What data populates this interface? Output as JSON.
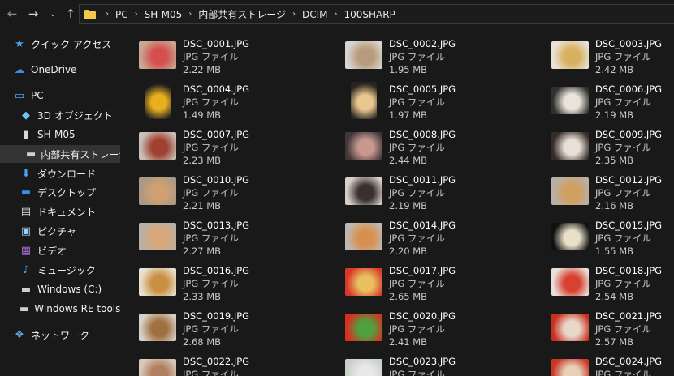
{
  "addressbar": {
    "back_icon": "arrow-left-icon",
    "forward_icon": "arrow-right-icon",
    "recent_icon": "chevron-down-icon",
    "up_icon": "arrow-up-icon",
    "crumbs": [
      "PC",
      "SH-M05",
      "内部共有ストレージ",
      "DCIM",
      "100SHARP"
    ]
  },
  "sidebar": {
    "items": [
      {
        "label": "クイック アクセス",
        "icon": "star-icon",
        "color": "#4aa3f0"
      },
      {
        "label": "OneDrive",
        "icon": "cloud-icon",
        "color": "#3b8ee8"
      },
      {
        "label": "PC",
        "icon": "computer-icon",
        "color": "#5aa8e8"
      },
      {
        "label": "3D オブジェクト",
        "icon": "cube-icon",
        "color": "#6bc4f0"
      },
      {
        "label": "SH-M05",
        "icon": "phone-icon",
        "color": "#cfd8e0"
      },
      {
        "label": "内部共有ストレージ",
        "icon": "drive-icon",
        "color": "#cfcfcf"
      },
      {
        "label": "ダウンロード",
        "icon": "download-icon",
        "color": "#4aa3f0"
      },
      {
        "label": "デスクトップ",
        "icon": "desktop-icon",
        "color": "#3b8ee8"
      },
      {
        "label": "ドキュメント",
        "icon": "document-icon",
        "color": "#dcdcdc"
      },
      {
        "label": "ピクチャ",
        "icon": "pictures-icon",
        "color": "#9ad0f5"
      },
      {
        "label": "ビデオ",
        "icon": "video-icon",
        "color": "#b070e0"
      },
      {
        "label": "ミュージック",
        "icon": "music-icon",
        "color": "#4aa3f0"
      },
      {
        "label": "Windows (C:)",
        "icon": "drive-icon",
        "color": "#cfcfcf"
      },
      {
        "label": "Windows RE tools (I",
        "icon": "drive-icon",
        "color": "#cfcfcf"
      },
      {
        "label": "ネットワーク",
        "icon": "network-icon",
        "color": "#5aa8e8"
      }
    ]
  },
  "files": [
    {
      "name": "DSC_0001.JPG",
      "type": "JPG ファイル",
      "size": "2.22 MB",
      "colors": [
        "#c8a890",
        "#d45050"
      ]
    },
    {
      "name": "DSC_0002.JPG",
      "type": "JPG ファイル",
      "size": "1.95 MB",
      "colors": [
        "#d8d4d0",
        "#b89a7c"
      ]
    },
    {
      "name": "DSC_0003.JPG",
      "type": "JPG ファイル",
      "size": "2.42 MB",
      "colors": [
        "#e8e2d8",
        "#d8b060"
      ]
    },
    {
      "name": "DSC_0004.JPG",
      "type": "JPG ファイル",
      "size": "1.49 MB",
      "colors": [
        "#1a1a20",
        "#e8b020"
      ]
    },
    {
      "name": "DSC_0005.JPG",
      "type": "JPG ファイル",
      "size": "1.97 MB",
      "colors": [
        "#2a2420",
        "#e8c890"
      ]
    },
    {
      "name": "DSC_0006.JPG",
      "type": "JPG ファイル",
      "size": "2.19 MB",
      "colors": [
        "#30302c",
        "#e8e4dc"
      ]
    },
    {
      "name": "DSC_0007.JPG",
      "type": "JPG ファイル",
      "size": "2.23 MB",
      "colors": [
        "#c8c0b8",
        "#a04030"
      ]
    },
    {
      "name": "DSC_0008.JPG",
      "type": "JPG ファイル",
      "size": "2.44 MB",
      "colors": [
        "#403838",
        "#c89890"
      ]
    },
    {
      "name": "DSC_0009.JPG",
      "type": "JPG ファイル",
      "size": "2.35 MB",
      "colors": [
        "#382c28",
        "#e8e0d8"
      ]
    },
    {
      "name": "DSC_0010.JPG",
      "type": "JPG ファイル",
      "size": "2.21 MB",
      "colors": [
        "#a89888",
        "#d0a070"
      ]
    },
    {
      "name": "DSC_0011.JPG",
      "type": "JPG ファイル",
      "size": "2.19 MB",
      "colors": [
        "#d8d0c8",
        "#3a3030"
      ]
    },
    {
      "name": "DSC_0012.JPG",
      "type": "JPG ファイル",
      "size": "2.16 MB",
      "colors": [
        "#b8b0a8",
        "#d0a060"
      ]
    },
    {
      "name": "DSC_0013.JPG",
      "type": "JPG ファイル",
      "size": "2.27 MB",
      "colors": [
        "#b8b0a8",
        "#d8a878"
      ]
    },
    {
      "name": "DSC_0014.JPG",
      "type": "JPG ファイル",
      "size": "2.20 MB",
      "colors": [
        "#c0b8b0",
        "#d89050"
      ]
    },
    {
      "name": "DSC_0015.JPG",
      "type": "JPG ファイル",
      "size": "1.55 MB",
      "colors": [
        "#101010",
        "#e8e0c8"
      ]
    },
    {
      "name": "DSC_0016.JPG",
      "type": "JPG ファイル",
      "size": "2.33 MB",
      "colors": [
        "#e8e0d0",
        "#c89040"
      ]
    },
    {
      "name": "DSC_0017.JPG",
      "type": "JPG ファイル",
      "size": "2.65 MB",
      "colors": [
        "#d83828",
        "#e8c060"
      ]
    },
    {
      "name": "DSC_0018.JPG",
      "type": "JPG ファイル",
      "size": "2.54 MB",
      "colors": [
        "#e8e0d8",
        "#d84030"
      ]
    },
    {
      "name": "DSC_0019.JPG",
      "type": "JPG ファイル",
      "size": "2.68 MB",
      "colors": [
        "#d8d0c8",
        "#a07040"
      ]
    },
    {
      "name": "DSC_0020.JPG",
      "type": "JPG ファイル",
      "size": "2.41 MB",
      "colors": [
        "#d83020",
        "#50a040"
      ]
    },
    {
      "name": "DSC_0021.JPG",
      "type": "JPG ファイル",
      "size": "2.57 MB",
      "colors": [
        "#c83020",
        "#e8d8c8"
      ]
    },
    {
      "name": "DSC_0022.JPG",
      "type": "JPG ファイル",
      "size": "",
      "colors": [
        "#d8c8b8",
        "#b08060"
      ]
    },
    {
      "name": "DSC_0023.JPG",
      "type": "JPG ファイル",
      "size": "",
      "colors": [
        "#c8d0c8",
        "#e8e8e8"
      ]
    },
    {
      "name": "DSC_0024.JPG",
      "type": "JPG ファイル",
      "size": "",
      "colors": [
        "#c83828",
        "#e8d0b8"
      ]
    }
  ]
}
